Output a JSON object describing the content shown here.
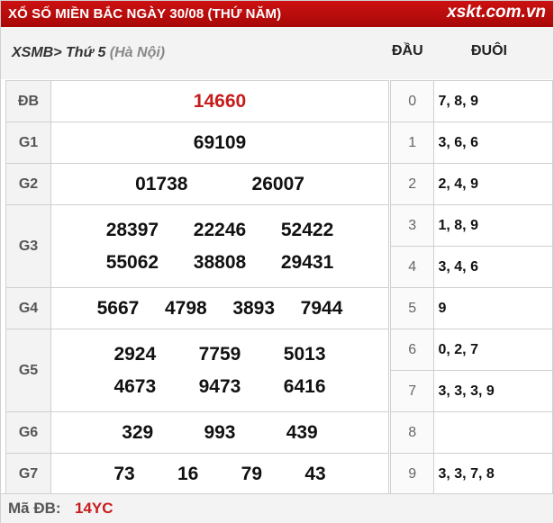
{
  "header": {
    "title": "XỔ SỐ MIỀN BẮC NGÀY 30/08 (THỨ NĂM)",
    "brand": "xskt.com.vn"
  },
  "subhead": {
    "code": "XSMB",
    "sep": ">",
    "day": " Thứ 5 ",
    "province": "(Hà Nội)",
    "col_dau": "ĐẦU",
    "col_duoi": "ĐUÔI"
  },
  "prizes": [
    {
      "label": "ĐB",
      "rows": [
        [
          "14660"
        ]
      ]
    },
    {
      "label": "G1",
      "rows": [
        [
          "69109"
        ]
      ]
    },
    {
      "label": "G2",
      "rows": [
        [
          "01738",
          "26007"
        ]
      ]
    },
    {
      "label": "G3",
      "rows": [
        [
          "28397",
          "22246",
          "52422"
        ],
        [
          "55062",
          "38808",
          "29431"
        ]
      ]
    },
    {
      "label": "G4",
      "rows": [
        [
          "5667",
          "4798",
          "3893",
          "7944"
        ]
      ]
    },
    {
      "label": "G5",
      "rows": [
        [
          "2924",
          "7759",
          "5013"
        ],
        [
          "4673",
          "9473",
          "6416"
        ]
      ]
    },
    {
      "label": "G6",
      "rows": [
        [
          "329",
          "993",
          "439"
        ]
      ]
    },
    {
      "label": "G7",
      "rows": [
        [
          "73",
          "16",
          "79",
          "43"
        ]
      ]
    }
  ],
  "dau_duoi": [
    {
      "dau": "0",
      "duoi": "7, 8, 9"
    },
    {
      "dau": "1",
      "duoi": "3, 6, 6"
    },
    {
      "dau": "2",
      "duoi": "2, 4, 9"
    },
    {
      "dau": "3",
      "duoi": "1, 8, 9"
    },
    {
      "dau": "4",
      "duoi": "3, 4, 6"
    },
    {
      "dau": "5",
      "duoi": "9"
    },
    {
      "dau": "6",
      "duoi": "0, 2, 7"
    },
    {
      "dau": "7",
      "duoi": "3, 3, 3, 9"
    },
    {
      "dau": "8",
      "duoi": ""
    },
    {
      "dau": "9",
      "duoi": "3, 3, 7, 8"
    }
  ],
  "footer": {
    "label": "Mã ĐB:",
    "value": "14YC"
  },
  "colors": {
    "header_red": "#b50d0d",
    "special_red": "#c81b1b"
  }
}
